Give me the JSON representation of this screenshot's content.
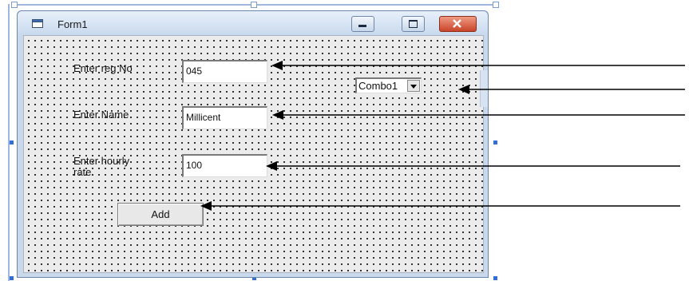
{
  "window": {
    "title": "Form1"
  },
  "controls": {
    "reg_label": "Enter reg No",
    "reg_value": "045",
    "combo_value": "Combo1",
    "name_label": "Enter Name",
    "name_value": "Millicent",
    "rate_label_line1": "Enter hourly",
    "rate_label_line2": "rate",
    "rate_value": "100",
    "add_button": "Add"
  },
  "icons": {
    "form_icon": "form-icon",
    "minimize": "minimize-icon",
    "maximize": "maximize-icon",
    "close": "close-icon",
    "combo_arrow": "chevron-down-icon"
  },
  "colors": {
    "close_button": "#d0472c",
    "title_bar": "#c8d9ee",
    "annotation_arrow": "#000000"
  }
}
